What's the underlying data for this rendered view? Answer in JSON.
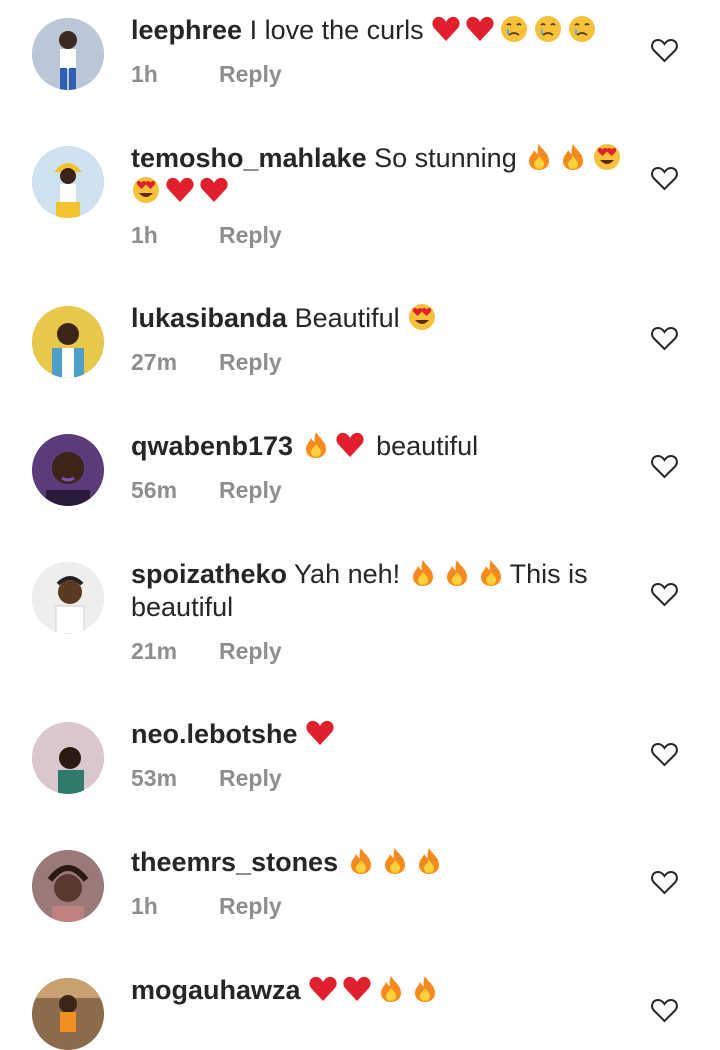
{
  "comments": [
    {
      "username": "leephree",
      "text": "I love the curls",
      "emojis": [
        "heart",
        "heart",
        "cry",
        "cry",
        "cry"
      ],
      "time": "1h",
      "reply_label": "Reply",
      "avatar_color": "#b9c7d6"
    },
    {
      "username": "temosho_mahlake",
      "text": "So stunning",
      "emojis": [
        "fire",
        "fire",
        "heart-eyes",
        "heart-eyes",
        "heart",
        "heart"
      ],
      "time": "1h",
      "reply_label": "Reply",
      "avatar_color": "#cfe0ef"
    },
    {
      "username": "lukasibanda",
      "text": "Beautiful",
      "emojis": [
        "heart-eyes"
      ],
      "time": "27m",
      "reply_label": "Reply",
      "avatar_color": "#e8c84a"
    },
    {
      "username": "qwabenb173",
      "text": "beautiful",
      "emojis": [
        "fire",
        "heart"
      ],
      "time": "56m",
      "reply_label": "Reply",
      "avatar_color": "#5b3b7a"
    },
    {
      "username": "spoizatheko",
      "text": "Yah neh!",
      "text_after": "This is beautiful",
      "emojis": [
        "fire",
        "fire",
        "fire"
      ],
      "time": "21m",
      "reply_label": "Reply",
      "avatar_color": "#eeeeee"
    },
    {
      "username": "neo.lebotshe",
      "text": "",
      "emojis": [
        "heart"
      ],
      "time": "53m",
      "reply_label": "Reply",
      "avatar_color": "#d9c6cf"
    },
    {
      "username": "theemrs_stones",
      "text": "",
      "emojis": [
        "fire",
        "fire",
        "fire"
      ],
      "time": "1h",
      "reply_label": "Reply",
      "avatar_color": "#9a7a78"
    },
    {
      "username": "mogauhawza",
      "text": "",
      "emojis": [
        "heart",
        "heart",
        "fire",
        "fire"
      ],
      "time": "",
      "reply_label": "",
      "avatar_color": "#8b6b4c"
    }
  ]
}
